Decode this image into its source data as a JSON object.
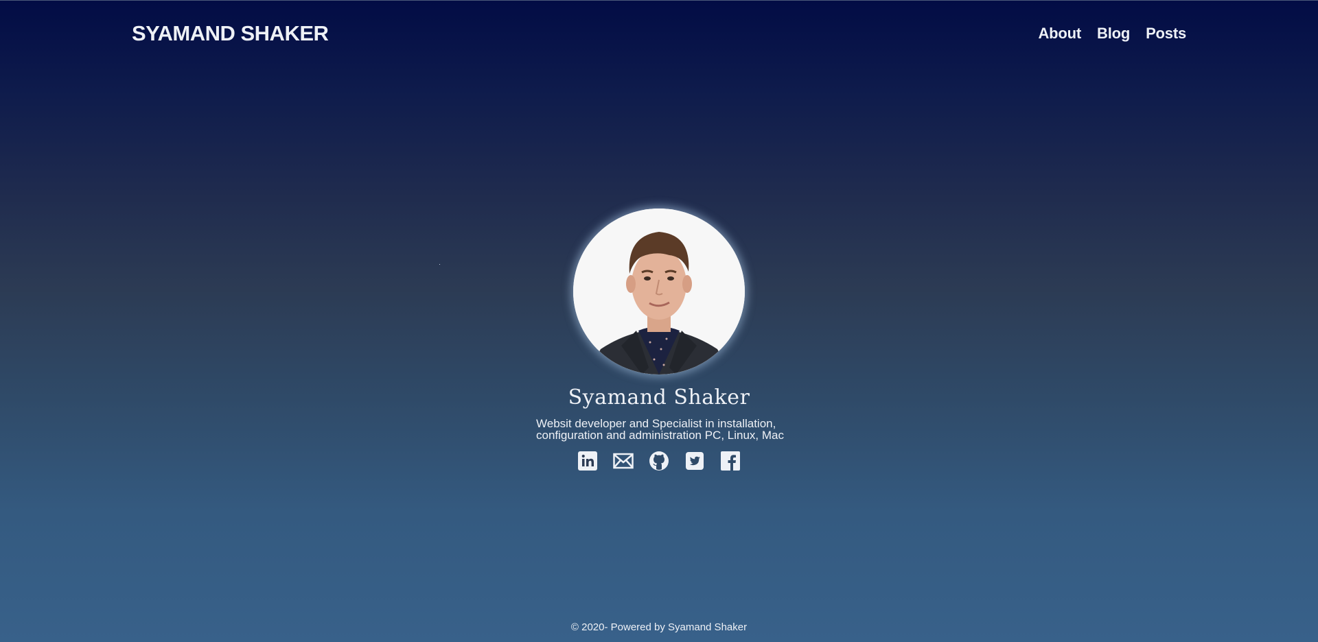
{
  "header": {
    "brand": "SYAMAND SHAKER",
    "nav": [
      {
        "label": "About"
      },
      {
        "label": "Blog"
      },
      {
        "label": "Posts"
      }
    ]
  },
  "profile": {
    "name": "Syamand Shaker",
    "bio_line1": "Websit developer and Specialist in installation,",
    "bio_line2": "configuration and administration PC, Linux, Mac",
    "avatar_icon": "profile-photo",
    "socials": [
      {
        "icon": "linkedin-icon"
      },
      {
        "icon": "mail-icon"
      },
      {
        "icon": "github-icon"
      },
      {
        "icon": "twitter-icon"
      },
      {
        "icon": "facebook-icon"
      }
    ]
  },
  "footer": {
    "text": "© 2020- Powered by Syamand Shaker"
  },
  "colors": {
    "gradient_top": "#020c45",
    "gradient_bottom": "#38618a",
    "text": "#eef1f6"
  }
}
